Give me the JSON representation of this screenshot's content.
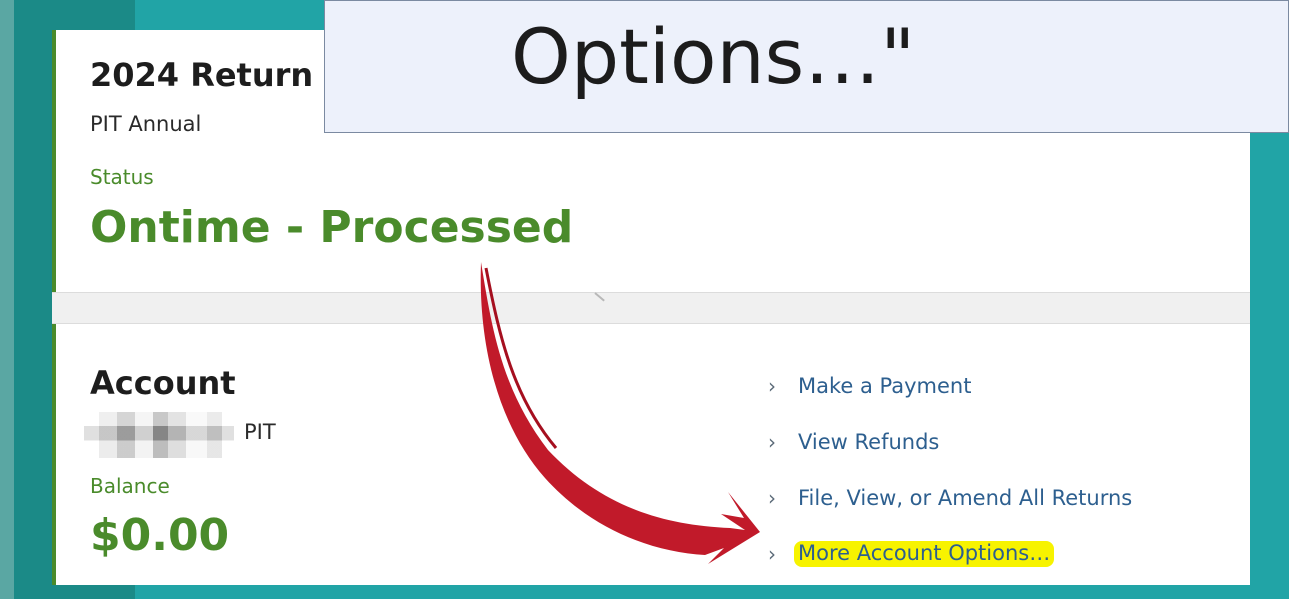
{
  "overlay": {
    "text": "Options…\""
  },
  "return_card": {
    "title": "2024 Return",
    "subtitle": "PIT Annual",
    "status_label": "Status",
    "status_value": "Ontime - Processed"
  },
  "account_card": {
    "title": "Account",
    "type": "PIT",
    "balance_label": "Balance",
    "balance_value": "$0.00",
    "links": [
      {
        "label": "Make a Payment",
        "highlighted": false
      },
      {
        "label": "View Refunds",
        "highlighted": false
      },
      {
        "label": "File, View, or Amend All Returns",
        "highlighted": false
      },
      {
        "label": "More Account Options…",
        "highlighted": true
      }
    ]
  },
  "colors": {
    "background_teal": "#21a4a6",
    "accent_green": "#4a8b2b",
    "link_blue": "#2d5f8f",
    "highlight_yellow": "#f7f300",
    "arrow_red": "#c11a2a"
  }
}
